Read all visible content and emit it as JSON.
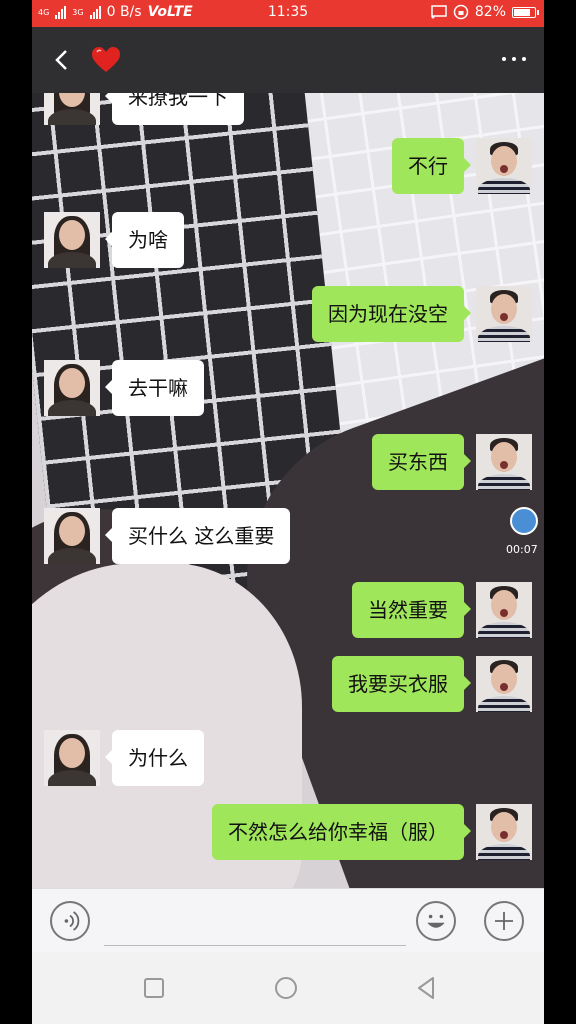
{
  "status_bar": {
    "network_a": "4G",
    "network_b": "3G",
    "speed": "0 B/s",
    "volte": "VoLTE",
    "time": "11:35",
    "battery": "82%",
    "battery_level": 0.82,
    "icons": [
      "signal-icon",
      "cast-icon",
      "alarm-lock-icon",
      "battery-icon"
    ],
    "color": "#e8382f"
  },
  "header": {
    "title_icon": "heart-icon",
    "back_icon": "back-arrow-icon",
    "menu_icon": "more-dots-icon"
  },
  "messages": [
    {
      "side": "in",
      "text": "来撩我一下"
    },
    {
      "side": "out",
      "text": "不行"
    },
    {
      "side": "in",
      "text": "为啥"
    },
    {
      "side": "out",
      "text": "因为现在没空"
    },
    {
      "side": "in",
      "text": "去干嘛"
    },
    {
      "side": "out",
      "text": "买东西"
    },
    {
      "side": "in",
      "text": "买什么  这么重要"
    },
    {
      "side": "out",
      "text": "当然重要"
    },
    {
      "side": "out",
      "text": "我要买衣服"
    },
    {
      "side": "in",
      "text": "为什么"
    },
    {
      "side": "out",
      "text": "不然怎么给你幸福（服）"
    }
  ],
  "floating_widget": {
    "time": "00:07"
  },
  "input_bar": {
    "value": "",
    "voice_icon": "voice-icon",
    "emoji_icon": "emoji-icon",
    "plus_icon": "plus-icon"
  },
  "nav_bar": {
    "icons": [
      "recent-apps-icon",
      "home-icon",
      "back-icon"
    ]
  },
  "colors": {
    "title_bar": "#2f2f31",
    "outgoing_bubble": "#9fe65a",
    "incoming_bubble": "#ffffff"
  }
}
